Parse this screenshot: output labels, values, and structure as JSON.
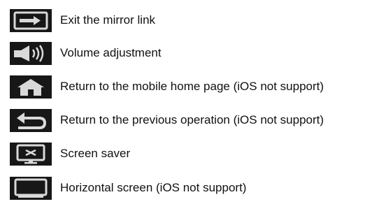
{
  "icon_color": "#171717",
  "glyph_color": "#d9d9d9",
  "items": [
    {
      "icon": "exit-mirror-link-icon",
      "label": "Exit the mirror link"
    },
    {
      "icon": "volume-icon",
      "label": "Volume adjustment"
    },
    {
      "icon": "home-icon",
      "label": "Return to the mobile home page (iOS not support)"
    },
    {
      "icon": "back-arrow-icon",
      "label": "Return to the previous operation (iOS not support)"
    },
    {
      "icon": "screen-saver-icon",
      "label": "Screen saver"
    },
    {
      "icon": "horizontal-screen-icon",
      "label": "Horizontal screen (iOS not support)"
    }
  ]
}
